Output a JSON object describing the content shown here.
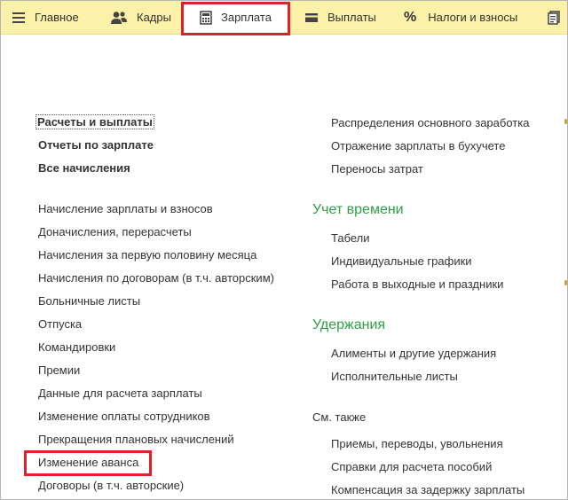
{
  "tabs": [
    {
      "label": "Главное",
      "icon": "hamburger-menu-icon"
    },
    {
      "label": "Кадры",
      "icon": "people-icon"
    },
    {
      "label": "Зарплата",
      "icon": "calculator-icon"
    },
    {
      "label": "Выплаты",
      "icon": "wallet-icon"
    },
    {
      "label": "Налоги и взносы",
      "icon": "percent-icon"
    },
    {
      "label": "",
      "icon": "document-icon"
    }
  ],
  "left_column": {
    "top_links": [
      "Расчеты и выплаты",
      "Отчеты по зарплате",
      "Все начисления"
    ],
    "links": [
      "Начисление зарплаты и взносов",
      "Доначисления, перерасчеты",
      "Начисления за первую половину месяца",
      "Начисления по договорам (в т.ч. авторским)",
      "Больничные листы",
      "Отпуска",
      "Командировки",
      "Премии",
      "Данные для расчета зарплаты",
      "Изменение оплаты сотрудников",
      "Прекращения плановых начислений",
      "Изменение аванса",
      "Договоры (в т.ч. авторские)"
    ]
  },
  "right_column": {
    "top_links": [
      "Распределения основного заработка",
      "Отражение зарплаты в бухучете",
      "Переносы затрат"
    ],
    "time_section": {
      "title": "Учет времени",
      "links": [
        "Табели",
        "Индивидуальные графики",
        "Работа в выходные и праздники"
      ]
    },
    "deductions_section": {
      "title": "Удержания",
      "links": [
        "Алименты и другие удержания",
        "Исполнительные листы"
      ]
    },
    "see_also": {
      "title": "См. также",
      "links": [
        "Приемы, переводы, увольнения",
        "Справки для расчета пособий",
        "Компенсация за задержку зарплаты"
      ]
    }
  },
  "colors": {
    "topbar": "#fbf1a9",
    "section_title": "#2e9e47",
    "highlight": "#e0212b"
  }
}
